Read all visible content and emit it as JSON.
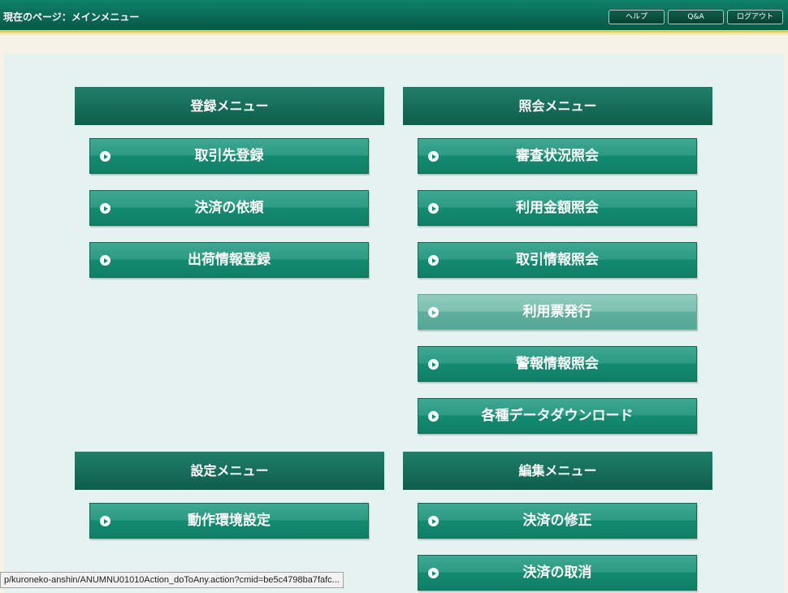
{
  "header": {
    "page_label": "現在のページ：メインメニュー",
    "help": "ヘルプ",
    "qa": "Q&A",
    "logout": "ログアウト"
  },
  "sections": {
    "register": {
      "title": "登録メニュー",
      "items": [
        "取引先登録",
        "決済の依頼",
        "出荷情報登録"
      ]
    },
    "inquiry": {
      "title": "照会メニュー",
      "items": [
        "審査状況照会",
        "利用金額照会",
        "取引情報照会",
        "利用票発行",
        "警報情報照会",
        "各種データダウンロード"
      ]
    },
    "settings": {
      "title": "設定メニュー",
      "items": [
        "動作環境設定"
      ]
    },
    "edit": {
      "title": "編集メニュー",
      "items": [
        "決済の修正",
        "決済の取消"
      ]
    }
  },
  "status_bar": {
    "url": "p/kuroneko-anshin/ANUMNU01010Action_doToAny.action?cmid=be5c4798ba7fafc..."
  },
  "colors": {
    "header_green": "#0a6a56",
    "button_green": "#138b70",
    "accent_gold": "#e3cf2e",
    "panel_bg": "#e5f3f0"
  }
}
